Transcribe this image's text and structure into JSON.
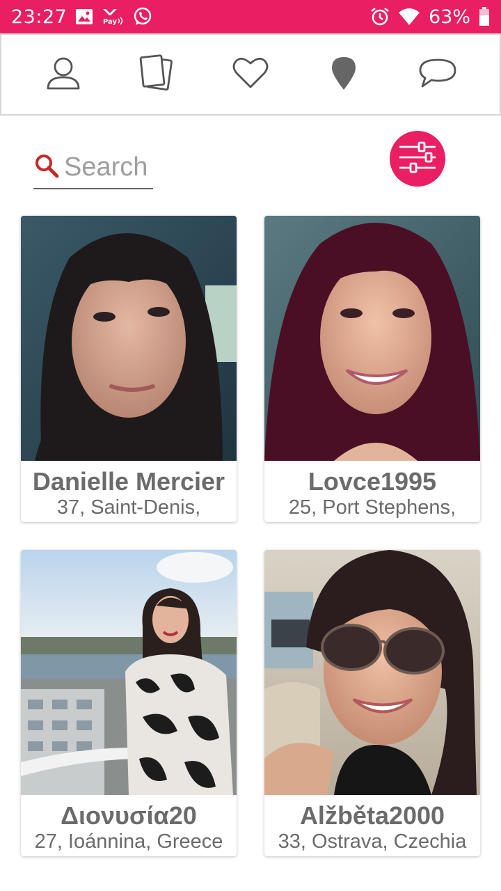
{
  "status_bar": {
    "time": "23:27",
    "battery": "63%",
    "left_icons": [
      "image-icon",
      "pay-icon",
      "whatsapp-icon"
    ],
    "right_icons": [
      "alarm-icon",
      "wifi-icon",
      "battery-icon"
    ]
  },
  "nav": {
    "items": [
      {
        "name": "profile",
        "icon": "person-icon"
      },
      {
        "name": "cards",
        "icon": "cards-icon"
      },
      {
        "name": "favorites",
        "icon": "heart-icon"
      },
      {
        "name": "nearby",
        "icon": "location-pin-icon"
      },
      {
        "name": "messages",
        "icon": "chat-bubble-icon"
      }
    ]
  },
  "search": {
    "placeholder": "Search",
    "value": ""
  },
  "filter": {
    "icon": "sliders-icon"
  },
  "colors": {
    "accent": "#e91e63",
    "text": "#6b6b6b",
    "nav_icon": "#555555"
  },
  "profiles": [
    {
      "name": "Danielle Mercier",
      "meta": "37, Saint-Denis,"
    },
    {
      "name": "Lovce1995",
      "meta": "25, Port Stephens,"
    },
    {
      "name": "Διονυσία20",
      "meta": "27, Ioánnina, Greece"
    },
    {
      "name": "Alžběta2000",
      "meta": "33, Ostrava, Czechia"
    }
  ]
}
